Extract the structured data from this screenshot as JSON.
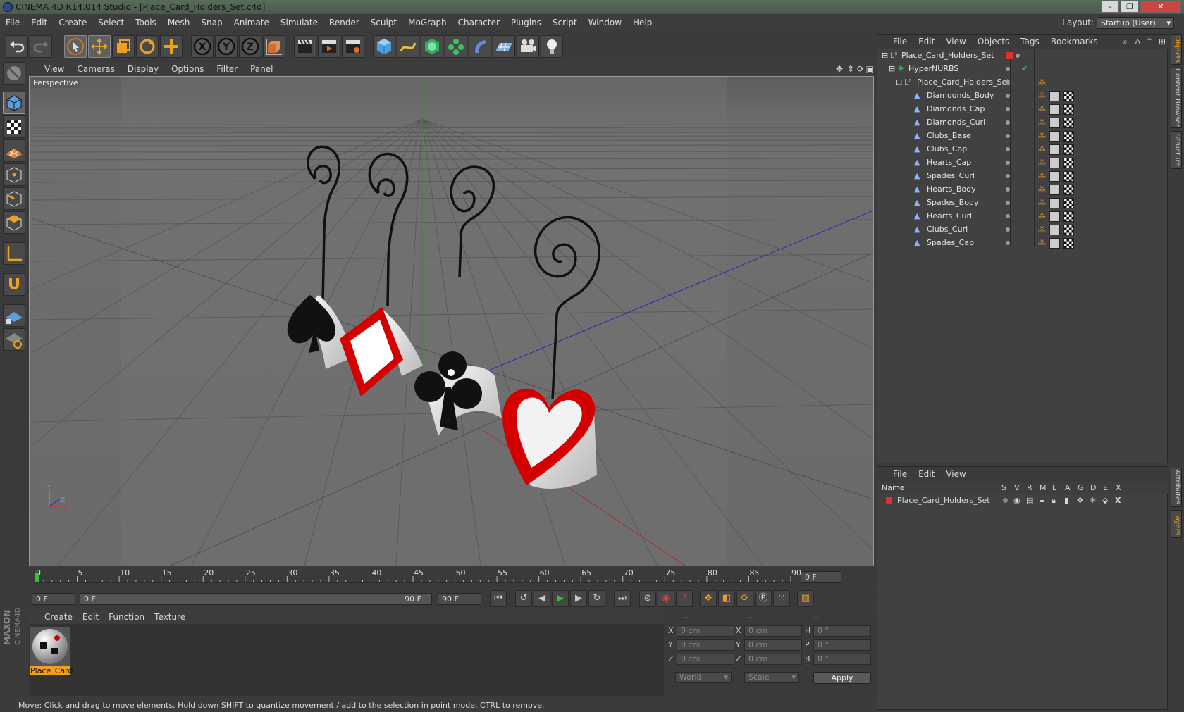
{
  "window": {
    "title": "CINEMA 4D R14.014 Studio - [Place_Card_Holders_Set.c4d]"
  },
  "menu": [
    "File",
    "Edit",
    "Create",
    "Select",
    "Tools",
    "Mesh",
    "Snap",
    "Animate",
    "Simulate",
    "Render",
    "Sculpt",
    "MoGraph",
    "Character",
    "Plugins",
    "Script",
    "Window",
    "Help"
  ],
  "layout": {
    "label": "Layout:",
    "value": "Startup (User)"
  },
  "viewport": {
    "menu": [
      "View",
      "Cameras",
      "Display",
      "Options",
      "Filter",
      "Panel"
    ],
    "label": "Perspective"
  },
  "timeline": {
    "ticks": [
      "0",
      "5",
      "10",
      "15",
      "20",
      "25",
      "30",
      "35",
      "40",
      "45",
      "50",
      "55",
      "60",
      "65",
      "70",
      "75",
      "80",
      "85",
      "90"
    ],
    "current_frame": "0 F",
    "start_field": "0 F",
    "range_start": "0 F",
    "range_end": "90 F",
    "end_field": "90 F"
  },
  "material_manager": {
    "menu": [
      "Create",
      "Edit",
      "Function",
      "Texture"
    ],
    "material_name": "Place_Card"
  },
  "coordinates": {
    "col_headers": [
      "--",
      "--",
      "--"
    ],
    "rows": [
      {
        "a": "X",
        "av": "0 cm",
        "b": "X",
        "bv": "0 cm",
        "c": "H",
        "cv": "0 °"
      },
      {
        "a": "Y",
        "av": "0 cm",
        "b": "Y",
        "bv": "0 cm",
        "c": "P",
        "cv": "0 °"
      },
      {
        "a": "Z",
        "av": "0 cm",
        "b": "Z",
        "bv": "0 cm",
        "c": "B",
        "cv": "0 °"
      }
    ],
    "mode1": "World",
    "mode2": "Scale",
    "apply": "Apply"
  },
  "status": "Move: Click and drag to move elements. Hold down SHIFT to quantize movement / add to the selection in point mode, CTRL to remove.",
  "objects": {
    "menu": [
      "File",
      "Edit",
      "View",
      "Objects",
      "Tags",
      "Bookmarks"
    ],
    "root": "Place_Card_Holders_Set",
    "nurbs": "HyperNURBS",
    "group": "Place_Card_Holders_Set",
    "children": [
      "Diamoonds_Body",
      "Diamonds_Cap",
      "Diamonds_Curl",
      "Clubs_Base",
      "Clubs_Cap",
      "Hearts_Cap",
      "Spades_Curl",
      "Hearts_Body",
      "Spades_Body",
      "Hearts_Curl",
      "Clubs_Curl",
      "Spades_Cap"
    ]
  },
  "layers": {
    "menu": [
      "File",
      "Edit",
      "View"
    ],
    "name_header": "Name",
    "cols": [
      "S",
      "V",
      "R",
      "M",
      "L",
      "A",
      "G",
      "D",
      "E",
      "X"
    ],
    "row": "Place_Card_Holders_Set"
  },
  "side_tabs": [
    "Objects",
    "Content Browser",
    "Structure",
    "Attributes",
    "Layers"
  ],
  "branding": "MAXON CINEMA 4D",
  "colors": {
    "accent_orange": "#f0a020",
    "layer_red": "#e03030",
    "heart_red": "#d40000",
    "play_green": "#30c030"
  }
}
